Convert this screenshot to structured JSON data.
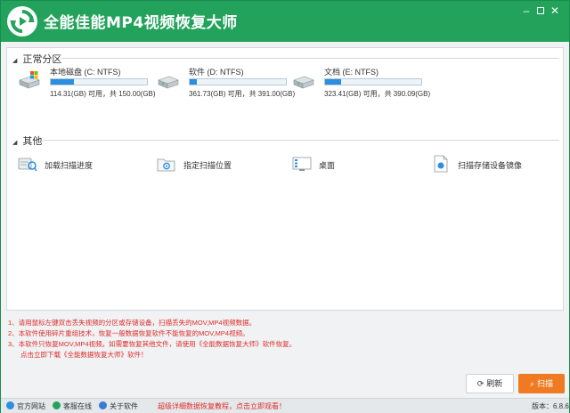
{
  "app": {
    "title": "全能佳能MP4视频恢复大师",
    "version": "版本：6.8.6"
  },
  "window_controls": {
    "minimize": "–",
    "close": "✕"
  },
  "colors": {
    "brand_green": "#23a25c",
    "scan_orange": "#f07a22",
    "note_red": "#e02b2b",
    "bar_blue": "#2a8fe1"
  },
  "partitions": {
    "heading": "正常分区",
    "drives": [
      {
        "name": "本地磁盘 (C: NTFS)",
        "size": "114.31(GB) 可用，共 150.00(GB)",
        "usage": 0.24,
        "icon": "system-drive-icon"
      },
      {
        "name": "软件 (D: NTFS)",
        "size": "361.73(GB) 可用，共 391.00(GB)",
        "usage": 0.07,
        "icon": "hard-drive-icon"
      },
      {
        "name": "文档 (E: NTFS)",
        "size": "323.41(GB) 可用，共 390.09(GB)",
        "usage": 0.17,
        "icon": "hard-drive-icon"
      }
    ]
  },
  "others": {
    "heading": "其他",
    "items": [
      {
        "label": "加载扫描进度",
        "icon": "scan-progress-icon"
      },
      {
        "label": "指定扫描位置",
        "icon": "scan-location-icon"
      },
      {
        "label": "桌面",
        "icon": "desktop-icon"
      },
      {
        "label": "扫描存储设备镜像",
        "icon": "device-image-icon"
      }
    ]
  },
  "notes": [
    "1、请用鼠标左键双击丢失视频的分区或存储设备，扫描丢失的MOV,MP4视频数据。",
    "2、本软件使用碎片重组技术，恢复一般数据恢复软件不能恢复的MOV,MP4视频。",
    "3、本软件只恢复MOV,MP4视频。如需要恢复其他文件，请使用《全能数据恢复大师》软件恢复。",
    "点击立即下载《全能数据恢复大师》软件！"
  ],
  "buttons": {
    "refresh": "刷新",
    "scan": "扫描"
  },
  "footer": {
    "links": [
      {
        "label": "官方网站",
        "icon": "globe-icon"
      },
      {
        "label": "客服在线",
        "icon": "chat-icon"
      },
      {
        "label": "关于软件",
        "icon": "info-icon"
      }
    ],
    "promo": "超级详细数据恢复教程，点击立即观看！"
  }
}
